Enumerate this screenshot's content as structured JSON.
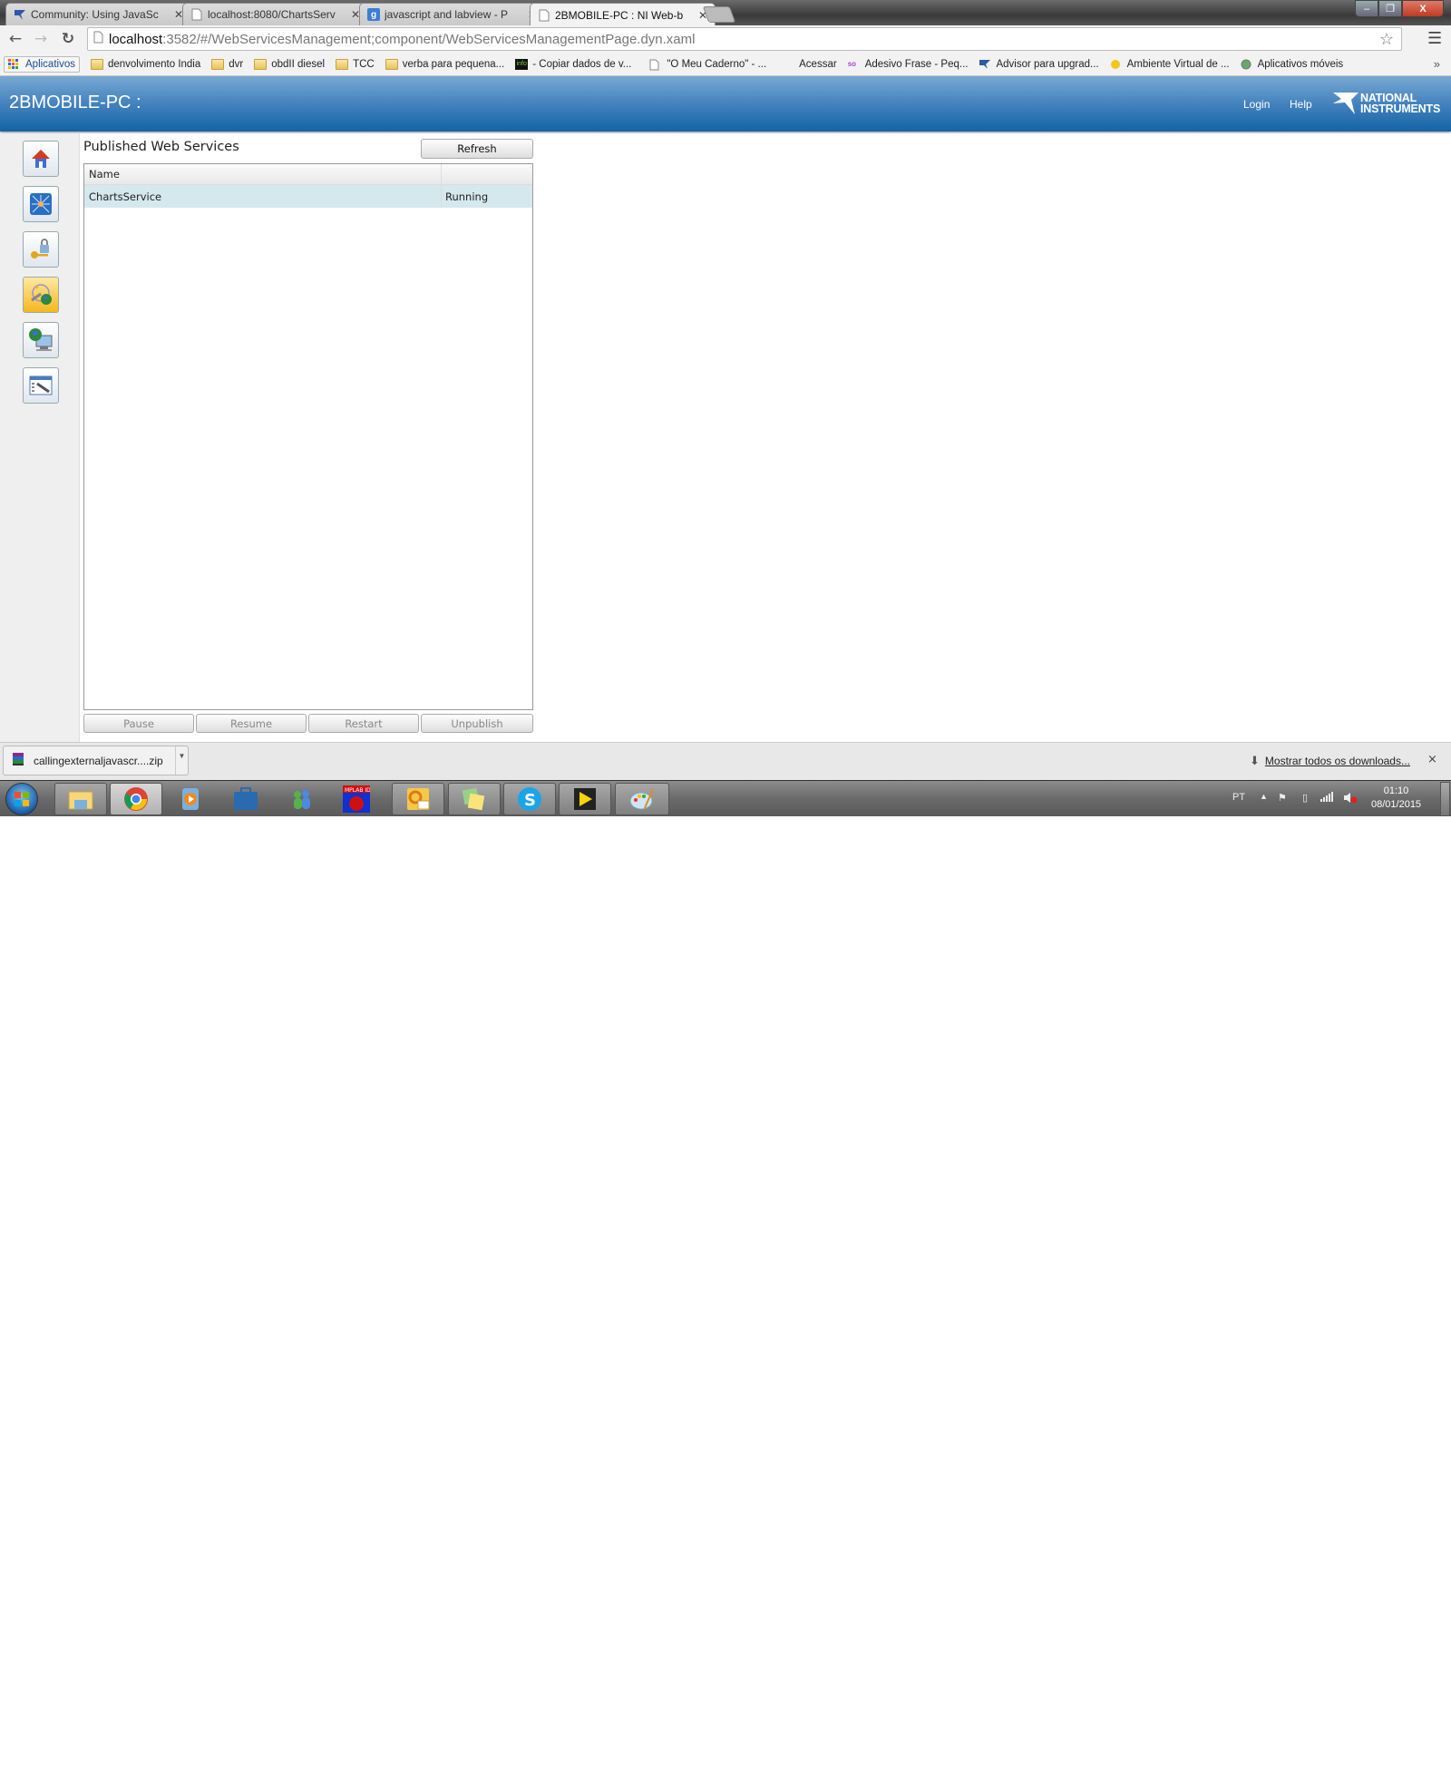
{
  "browser": {
    "tabs": [
      {
        "title": "Community: Using JavaSc",
        "icon": "ni-logo-icon",
        "active": false
      },
      {
        "title": "localhost:8080/ChartsServ",
        "icon": "page-icon",
        "active": false
      },
      {
        "title": "javascript and labview - P",
        "icon": "google-icon",
        "active": false
      },
      {
        "title": "2BMOBILE-PC : NI Web-b",
        "icon": "page-icon",
        "active": true
      }
    ],
    "address": {
      "host": "localhost",
      "rest": ":3582/#/WebServicesManagement;component/WebServicesManagementPage.dyn.xaml"
    },
    "bookmarks": [
      {
        "label": "Aplicativos",
        "icon": "apps-grid-icon"
      },
      {
        "label": "denvolvimento India",
        "icon": "folder-icon"
      },
      {
        "label": "dvr",
        "icon": "folder-icon"
      },
      {
        "label": "obdII diesel",
        "icon": "folder-icon"
      },
      {
        "label": "TCC",
        "icon": "folder-icon"
      },
      {
        "label": "verba para pequena...",
        "icon": "folder-icon"
      },
      {
        "label": "- Copiar dados de v...",
        "icon": "info-icon"
      },
      {
        "label": "\"O Meu Caderno\" - ...",
        "icon": "page-icon"
      },
      {
        "label": "Acessar",
        "icon": ""
      },
      {
        "label": "Adesivo Frase - Peq...",
        "icon": "so-icon"
      },
      {
        "label": "Advisor para upgrad...",
        "icon": "ni-logo-icon"
      },
      {
        "label": "Ambiente Virtual de ...",
        "icon": "bulb-icon"
      },
      {
        "label": "Aplicativos móveis",
        "icon": "android-icon"
      }
    ],
    "more_bookmarks": "»",
    "window_controls": {
      "minimize": "‒",
      "maximize": "❐",
      "close": "X"
    }
  },
  "app": {
    "host_title": "2BMOBILE-PC :",
    "header_links": {
      "login": "Login",
      "help": "Help"
    },
    "logo": {
      "line1": "NATIONAL",
      "line2": "INSTRUMENTS"
    },
    "sidebar": [
      {
        "name": "home",
        "active": false
      },
      {
        "name": "network",
        "active": false
      },
      {
        "name": "security",
        "active": false
      },
      {
        "name": "web-services",
        "active": true
      },
      {
        "name": "web-server",
        "active": false
      },
      {
        "name": "configuration",
        "active": false
      }
    ],
    "page_title": "Published Web Services",
    "refresh_label": "Refresh",
    "table": {
      "columns": [
        "Name",
        ""
      ],
      "rows": [
        {
          "name": "ChartsService",
          "status": "Running"
        }
      ]
    },
    "actions": {
      "pause": "Pause",
      "resume": "Resume",
      "restart": "Restart",
      "unpublish": "Unpublish"
    }
  },
  "downloads": {
    "file": "callingexternaljavascr....zip",
    "show_all": "Mostrar todos os downloads...",
    "close": "×"
  },
  "taskbar": {
    "apps": [
      "windows-explorer",
      "chrome",
      "media-player",
      "toolbox",
      "messenger",
      "mplab-ide",
      "outlook",
      "sticky-notes",
      "skype",
      "labview",
      "paint"
    ],
    "language": "PT",
    "time": "01:10",
    "date": "08/01/2015"
  }
}
